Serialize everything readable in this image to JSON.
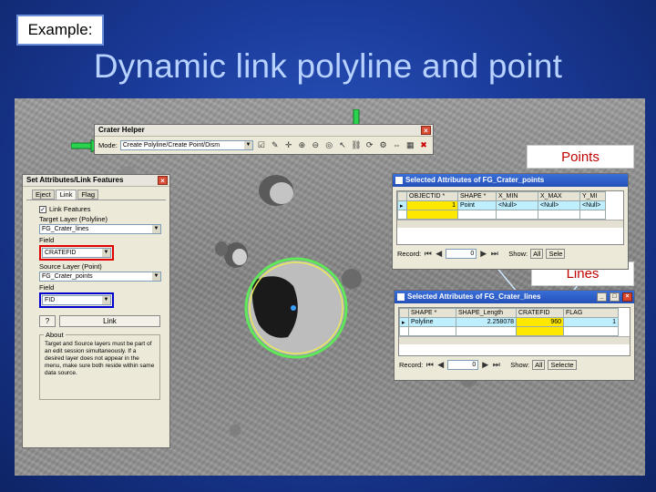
{
  "slide": {
    "example_label": "Example:",
    "title": "Dynamic link polyline and point"
  },
  "crater_helper": {
    "title": "Crater Helper",
    "mode_label": "Mode:",
    "mode_value": "Create Polyline/Create Point/Dism",
    "close": "×"
  },
  "set_attributes": {
    "title": "Set Attributes/Link Features",
    "tabs": [
      "Eject",
      "Link",
      "Flag"
    ],
    "link_features_label": "Link Features",
    "target_layer_label": "Target Layer (Polyline)",
    "target_layer_value": "FG_Crater_lines",
    "field_label": "Field",
    "field_value": "CRATEFID",
    "source_layer_label": "Source Layer (Point)",
    "source_layer_value": "FG_Crater_points",
    "field2_label": "Field",
    "field2_value": "FID",
    "help_button": "?",
    "link_button": "Link",
    "about_label": "About",
    "about_text": "Target and Source layers must be part of an edit session simultaneously. If a desired layer does not appear in the menu, make sure both reside within same data source."
  },
  "points_label": "Points",
  "lines_label": "Lines",
  "points_table": {
    "title": "Selected Attributes of FG_Crater_points",
    "columns": [
      "OBJECTID *",
      "SHAPE *",
      "X_MIN",
      "X_MAX",
      "Y_MI"
    ],
    "rows": [
      [
        "1",
        "Point",
        "<Null>",
        "<Null>",
        "<Null>"
      ]
    ],
    "record_label": "Record:",
    "record_value": "0",
    "show_label": "Show:",
    "show_value": "All",
    "selected_value": "Sele"
  },
  "lines_table": {
    "title": "Selected Attributes of FG_Crater_lines",
    "columns": [
      "SHAPE *",
      "SHAPE_Length",
      "CRATEFID",
      "FLAG"
    ],
    "rows": [
      [
        "Polyline",
        "2.258078",
        "960",
        "1"
      ]
    ],
    "record_label": "Record:",
    "record_value": "0",
    "show_label": "Show:",
    "show_value": "All",
    "selected_value": "Selecte"
  },
  "colors": {
    "background": "#1b3c9c",
    "title_text": "#b8d2ff",
    "highlight_red": "#e00000",
    "highlight_blue": "#0000d0",
    "arrow_green": "#2bd24e",
    "crater_ring": "#5ee85a"
  }
}
